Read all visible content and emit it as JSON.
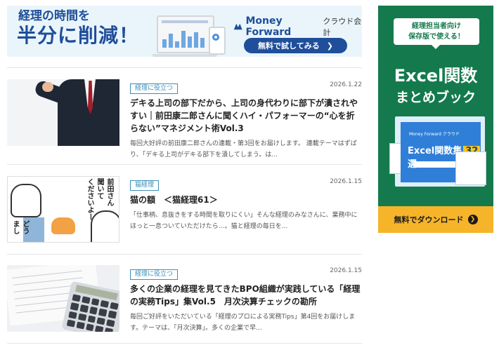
{
  "top_banner": {
    "headline_line1": "経理の時間を",
    "headline_line2": "半分に削減！",
    "brand": "Money Forward",
    "brand_sub": "クラウド会計",
    "cta_label": "無料で試してみる",
    "cta_icon": "chevron-right-icon",
    "brand_color": "#1f4e9a"
  },
  "articles": [
    {
      "tag": "経理に役立つ",
      "date": "2026.1.22",
      "title": "デキる上司の部下だから、上司の身代わりに部下が潰されやすい｜前田康二郎さんに聞くハイ・パフォーマーの“心を折らない”マネジメント術Vol.3",
      "excerpt": "毎回大好評の前田康二郎さんの連載・第3回をお届けします。 連載テーマはずばり、「デキる上司がデキる部下を潰してしまう。は..."
    },
    {
      "tag": "猫経理",
      "date": "2026.1.15",
      "title": "猫の額　＜猫経理61＞",
      "excerpt": "「仕事柄、息抜きをする時間を取りにくい」そんな経理のみなさんに、業務中にほっと一息ついていただけたら…。猫と経理の毎日を...",
      "thumb_text": [
        "前田さん",
        "聞いて",
        "くださいよー",
        "どう",
        "まし"
      ]
    },
    {
      "tag": "経理に役立つ",
      "date": "2026.1.15",
      "title": "多くの企業の経理を見てきたBPO組織が実践している「経理の実務Tips」集Vol.5　月次決算チェックの勘所",
      "excerpt": "毎回ご好評をいただいている「経理のプロによる実務Tips」第4回をお届けします。テーマは、「月次決算」。多くの企業で早..."
    }
  ],
  "side_ad": {
    "badge_line1": "経理担当者向け",
    "badge_line2": "保存版で使える！",
    "title_line1": "Excel関数",
    "title_line2": "まとめブック",
    "book_brand": "Money Forward クラウド",
    "book_title": "Excel関数集",
    "book_number": "32",
    "book_suffix": "選",
    "cta_label": "無料でダウンロード",
    "bg_color": "#147a4d",
    "cta_color": "#f5b42a"
  }
}
